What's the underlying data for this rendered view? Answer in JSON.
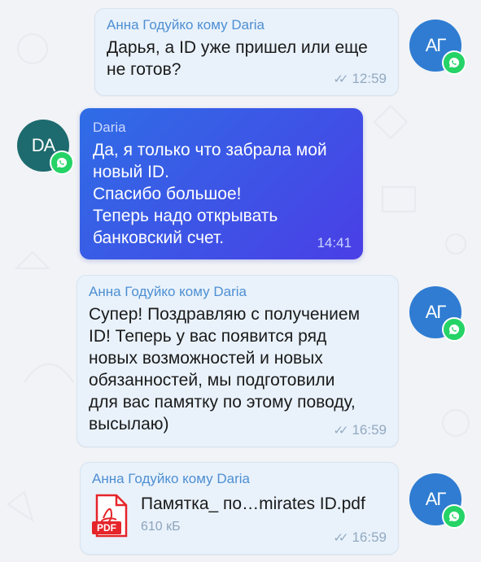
{
  "messages": [
    {
      "sender": "Анна Годуйко  кому Daria",
      "text": "Дарья, а ID уже пришел или еще\nне готов?",
      "time": "12:59",
      "avatar": "АГ"
    },
    {
      "sender": "Daria",
      "text": "Да, я только что забрала мой\nновый ID.\nСпасибо большое!\nТеперь надо открывать\nбанковский счет.",
      "time": "14:41",
      "avatar": "DA"
    },
    {
      "sender": "Анна Годуйко  кому Daria",
      "text": "Супер! Поздравляю с получением\nID! Теперь у вас появится ряд\nновых возможностей и новых\nобязанностей, мы подготовили\nдля вас памятку по этому поводу,\nвысылаю)",
      "time": "16:59",
      "avatar": "АГ"
    },
    {
      "sender": "Анна Годуйко  кому Daria",
      "file_name": "Памятка_ по…mirates ID.pdf",
      "file_size": "610 кБ",
      "file_type": "PDF",
      "time": "16:59",
      "avatar": "АГ"
    }
  ],
  "colors": {
    "outgoing_bubble": "#e9f2fb",
    "incoming_gradient_start": "#2f6de6",
    "incoming_gradient_end": "#4a3fe6",
    "sender_name": "#4e8fd2",
    "whatsapp_badge": "#25d366",
    "pdf_red": "#e5252a"
  }
}
